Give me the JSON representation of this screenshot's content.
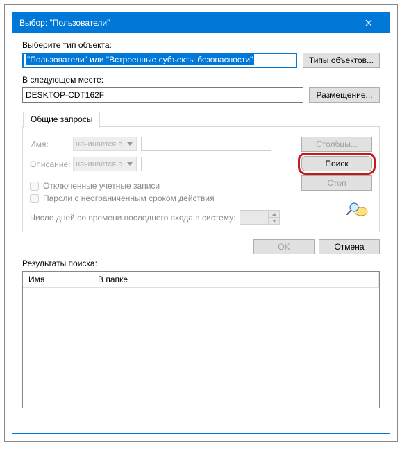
{
  "titlebar": {
    "title": "Выбор: \"Пользователи\""
  },
  "labels": {
    "object_type": "Выберите тип объекта:",
    "location": "В следующем месте:",
    "results": "Результаты поиска:"
  },
  "fields": {
    "object_type_value": "\"Пользователи\" или \"Встроенные субъекты безопасности\"",
    "location_value": "DESKTOP-CDT162F"
  },
  "buttons": {
    "object_types": "Типы объектов...",
    "locations": "Размещение...",
    "columns": "Столбцы...",
    "find_now": "Поиск",
    "stop": "Стоп",
    "ok": "OK",
    "cancel": "Отмена"
  },
  "tab": {
    "label": "Общие запросы",
    "name_label": "Имя:",
    "desc_label": "Описание:",
    "select_option": "начинается с",
    "checkbox_disabled": "Отключенные учетные записи",
    "checkbox_pwd": "Пароли с неограниченным сроком действия",
    "days_label": "Число дней со времени последнего входа в систему:"
  },
  "grid": {
    "col_name": "Имя",
    "col_folder": "В папке"
  }
}
